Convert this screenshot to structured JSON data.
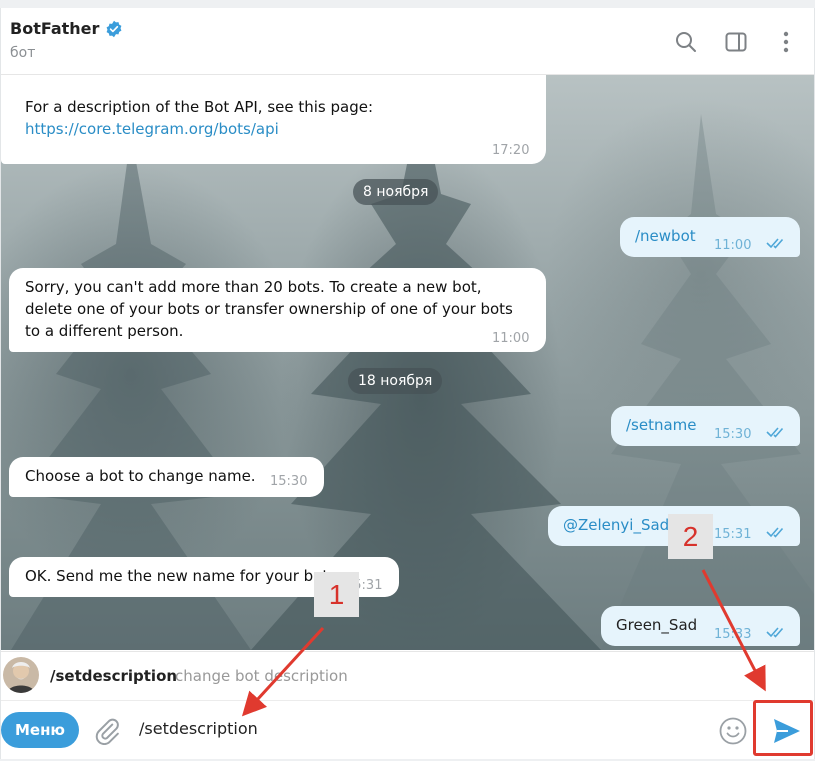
{
  "header": {
    "title": "BotFather",
    "subtitle": "бот",
    "icons": [
      "search-icon",
      "sidebar-toggle-icon",
      "more-vertical-icon"
    ]
  },
  "messages": {
    "m1": {
      "text": "For a description of the Bot API, see this page:",
      "link": "https://core.telegram.org/bots/api",
      "time": "17:20"
    },
    "date1": "8 ноября",
    "m2": {
      "text": "/newbot",
      "time": "11:00"
    },
    "m3": {
      "line1": "Sorry, you can't add more than 20 bots. To create a new bot,",
      "line2": "delete one of your bots or transfer ownership of one of your bots",
      "line3": "to a different person.",
      "time": "11:00"
    },
    "date2": "18 ноября",
    "m4": {
      "text": "/setname",
      "time": "15:30"
    },
    "m5": {
      "text": "Choose a bot to change name.",
      "time": "15:30"
    },
    "m6": {
      "text": "@Zelenyi_Sad_bot",
      "time": "15:31"
    },
    "m7": {
      "text": "OK. Send me the new name for your bot.",
      "time": "15:31"
    },
    "m8": {
      "text": "Green_Sad",
      "time": "15:33"
    }
  },
  "command_suggestion": {
    "command": "/setdescription",
    "description": "change bot description"
  },
  "input": {
    "menu_label": "Меню",
    "value": "/setdescription"
  },
  "annotations": {
    "marker1": "1",
    "marker2": "2"
  },
  "colors": {
    "accent": "#3b9ddb",
    "outgoing_bubble": "#e6f4fc",
    "highlight_red": "#e03a2f"
  }
}
